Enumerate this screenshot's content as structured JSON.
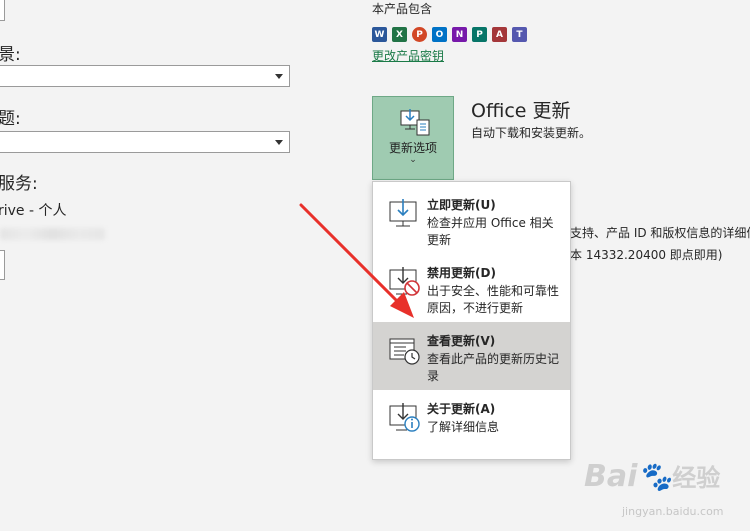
{
  "left": {
    "bg_label": "景:",
    "theme_label": "题:",
    "services_label": "服务:",
    "onedrive": "rive - 个人"
  },
  "products": {
    "header": "本产品包含",
    "icons": [
      {
        "name": "word-icon",
        "letter": "W",
        "color": "#2b579a"
      },
      {
        "name": "excel-icon",
        "letter": "X",
        "color": "#217346"
      },
      {
        "name": "powerpoint-icon",
        "letter": "P",
        "color": "#d24726"
      },
      {
        "name": "outlook-icon",
        "letter": "O",
        "color": "#0072c6"
      },
      {
        "name": "onenote-icon",
        "letter": "N",
        "color": "#7719aa"
      },
      {
        "name": "publisher-icon",
        "letter": "P",
        "color": "#077568"
      },
      {
        "name": "access-icon",
        "letter": "A",
        "color": "#a4373a"
      },
      {
        "name": "teams-icon",
        "letter": "T",
        "color": "#5558af"
      }
    ],
    "change_key": "更改产品密钥"
  },
  "updates": {
    "button_label": "更新选项",
    "title": "Office 更新",
    "subtitle": "自动下载和安装更新。",
    "about_line1": "支持、产品 ID 和版权信息的详细信",
    "about_line2": "本 14332.20400 即点即用)"
  },
  "menu": {
    "items": [
      {
        "title": "立即更新(U)",
        "desc": "检查并应用 Office 相关更新"
      },
      {
        "title": "禁用更新(D)",
        "desc": "出于安全、性能和可靠性原因，不进行更新"
      },
      {
        "title": "查看更新(V)",
        "desc": "查看此产品的更新历史记录"
      },
      {
        "title": "关于更新(A)",
        "desc": "了解详细信息"
      }
    ]
  },
  "watermark": {
    "brand": "Bai",
    "brand_cn": "经验",
    "url": "jingyan.baidu.com"
  },
  "colors": {
    "accent_green": "#9fcbb1",
    "link_green": "#1a7a47",
    "highlight": "#d4d3d1",
    "arrow_red": "#e8302a"
  }
}
